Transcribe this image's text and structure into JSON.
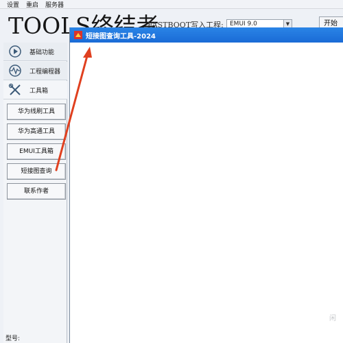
{
  "menu": [
    "设置",
    "重启",
    "服务器"
  ],
  "brand": "TOOLS终结者",
  "fastboot_label": "FASTBOOT写入工程:",
  "emui_combo_value": "EMUI 9.0",
  "start_button_label": "开始",
  "sidebar": {
    "nav": [
      {
        "label": "基础功能",
        "icon": "play-circle-icon"
      },
      {
        "label": "工程编程器",
        "icon": "waveform-icon"
      },
      {
        "label": "工具箱",
        "icon": "wrench-screwdriver-icon"
      }
    ],
    "buttons": [
      "华为线刷工具",
      "华为高通工具",
      "EMUI工具箱",
      "短接图查询",
      "联系作者"
    ],
    "model_label": "型号:"
  },
  "dialog": {
    "title": "短接图查询工具-2024",
    "title_color": "#1a6bd6"
  },
  "annotation_arrow_color": "#e0401f",
  "watermark": "闲"
}
